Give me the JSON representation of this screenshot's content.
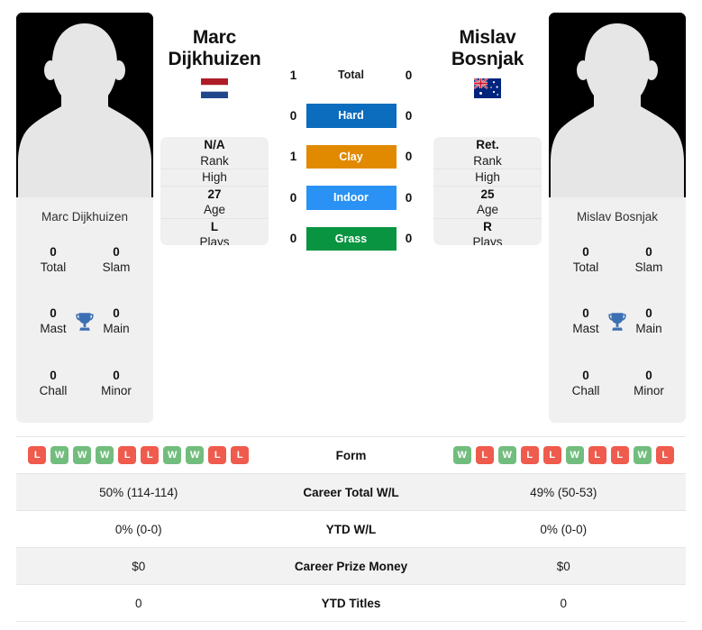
{
  "players": {
    "left": {
      "first_name": "Marc",
      "last_name": "Dijkhuizen",
      "full_name": "Marc Dijkhuizen",
      "country": "Netherlands",
      "flag_icon": "flag-netherlands-icon",
      "rank": "N/A",
      "rank_label": "Rank",
      "high_rank": "",
      "high_label": "High",
      "age": "27",
      "age_label": "Age",
      "plays": "L",
      "plays_label": "Plays",
      "titles": [
        {
          "value": "0",
          "label": "Total"
        },
        {
          "value": "0",
          "label": "Slam"
        },
        {
          "value": "0",
          "label": "Mast"
        },
        {
          "value": "0",
          "label": "Main"
        },
        {
          "value": "0",
          "label": "Chall"
        },
        {
          "value": "0",
          "label": "Minor"
        }
      ],
      "form": [
        "L",
        "W",
        "W",
        "W",
        "L",
        "L",
        "W",
        "W",
        "L",
        "L"
      ],
      "career_total_wl": "50% (114-114)",
      "ytd_wl": "0% (0-0)",
      "career_prize_money": "$0",
      "ytd_titles": "0"
    },
    "right": {
      "first_name": "Mislav",
      "last_name": "Bosnjak",
      "full_name": "Mislav Bosnjak",
      "country": "Australia",
      "flag_icon": "flag-australia-icon",
      "rank": "Ret.",
      "rank_label": "Rank",
      "high_rank": "",
      "high_label": "High",
      "age": "25",
      "age_label": "Age",
      "plays": "R",
      "plays_label": "Plays",
      "titles": [
        {
          "value": "0",
          "label": "Total"
        },
        {
          "value": "0",
          "label": "Slam"
        },
        {
          "value": "0",
          "label": "Mast"
        },
        {
          "value": "0",
          "label": "Main"
        },
        {
          "value": "0",
          "label": "Chall"
        },
        {
          "value": "0",
          "label": "Minor"
        }
      ],
      "form": [
        "W",
        "L",
        "W",
        "L",
        "L",
        "W",
        "L",
        "L",
        "W",
        "L"
      ],
      "career_total_wl": "49% (50-53)",
      "ytd_wl": "0% (0-0)",
      "career_prize_money": "$0",
      "ytd_titles": "0"
    }
  },
  "head_to_head": [
    {
      "label": "Total",
      "left": "1",
      "right": "0",
      "color": "",
      "style": "plain"
    },
    {
      "label": "Hard",
      "left": "0",
      "right": "0",
      "color": "#0c6cbd",
      "style": "badge"
    },
    {
      "label": "Clay",
      "left": "1",
      "right": "0",
      "color": "#e18a00",
      "style": "badge"
    },
    {
      "label": "Indoor",
      "left": "0",
      "right": "0",
      "color": "#2a92f5",
      "style": "badge"
    },
    {
      "label": "Grass",
      "left": "0",
      "right": "0",
      "color": "#089440",
      "style": "badge"
    }
  ],
  "stats_rows": [
    {
      "label": "Form",
      "key": "form",
      "type": "form"
    },
    {
      "label": "Career Total W/L",
      "key": "career_total_wl",
      "type": "text"
    },
    {
      "label": "YTD W/L",
      "key": "ytd_wl",
      "type": "text"
    },
    {
      "label": "Career Prize Money",
      "key": "career_prize_money",
      "type": "text"
    },
    {
      "label": "YTD Titles",
      "key": "ytd_titles",
      "type": "text"
    }
  ],
  "colors": {
    "hard": "#0c6cbd",
    "clay": "#e18a00",
    "indoor": "#2a92f5",
    "grass": "#089440",
    "win_badge": "#72bd7e",
    "loss_badge": "#ef5b4c",
    "trophy": "#3d6fb4",
    "card_bg": "#f0f0f0",
    "row_alt_bg": "#f2f2f2"
  }
}
